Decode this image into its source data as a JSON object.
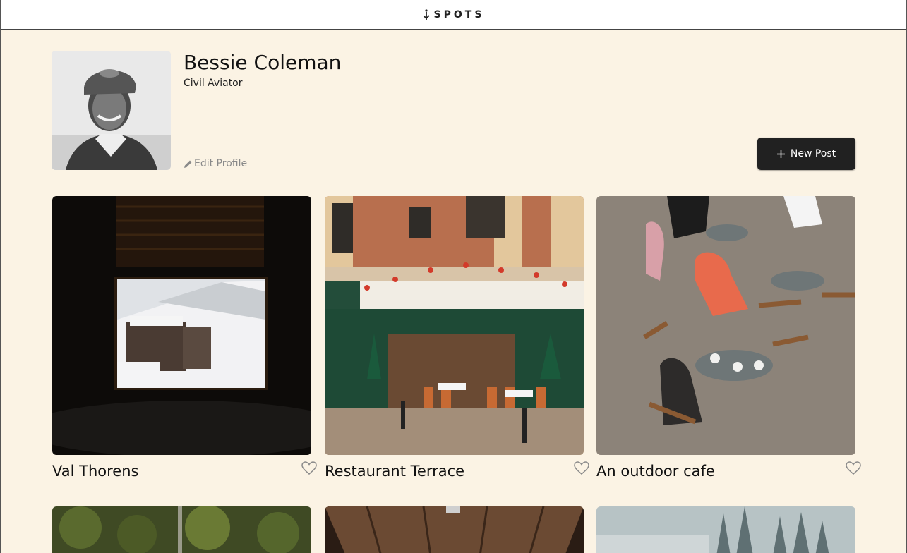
{
  "header": {
    "logo_text": "SPOTS"
  },
  "profile": {
    "name": "Bessie Coleman",
    "job": "Civil Aviator",
    "edit_label": "Edit Profile",
    "new_post_label": "New Post"
  },
  "cards": [
    {
      "title": "Val Thorens"
    },
    {
      "title": "Restaurant Terrace"
    },
    {
      "title": "An outdoor cafe"
    }
  ],
  "colors": {
    "background": "#fbf3e4",
    "button": "#212121",
    "muted": "#8a8a8a"
  },
  "icons": [
    "logo-icon",
    "pencil-icon",
    "plus-icon",
    "heart-icon"
  ]
}
